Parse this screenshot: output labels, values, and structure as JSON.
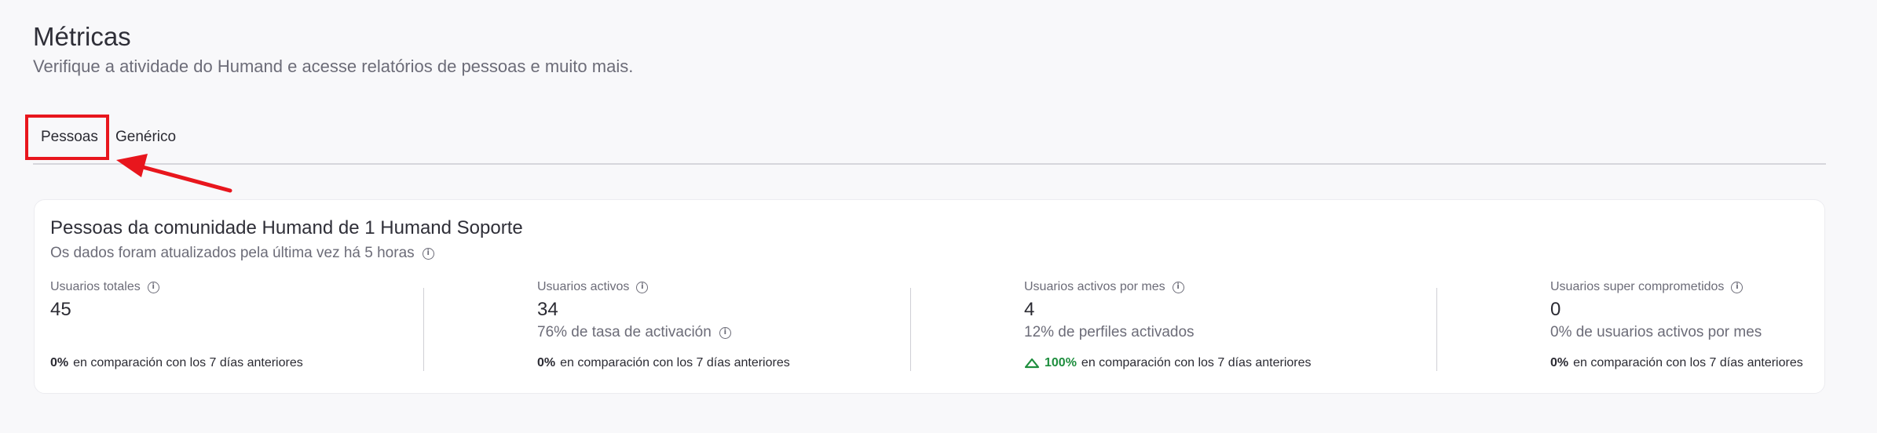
{
  "header": {
    "title": "Métricas",
    "subtitle": "Verifique a atividade do Humand e acesse relatórios de pessoas e muito mais."
  },
  "tabs": [
    {
      "label": "Pessoas",
      "selected": true
    },
    {
      "label": "Genérico",
      "selected": false
    }
  ],
  "card": {
    "title": "Pessoas da comunidade Humand de 1 Humand Soporte",
    "updated": "Os dados foram atualizados pela última vez há 5 horas",
    "metrics": [
      {
        "label": "Usuarios totales",
        "value": "45",
        "extra": "",
        "compare_pct": "0%",
        "compare_text": "en comparación con los 7 días anteriores"
      },
      {
        "label": "Usuarios activos",
        "value": "34",
        "extra": "76% de tasa de activación",
        "compare_pct": "0%",
        "compare_text": "en comparación con los 7 días anteriores"
      },
      {
        "label": "Usuarios activos por mes",
        "value": "4",
        "extra": "12% de perfiles activados",
        "compare_pct": "100%",
        "compare_text": "en comparación con los 7 días anteriores"
      },
      {
        "label": "Usuarios super comprometidos",
        "value": "0",
        "extra": "0% de usuarios activos por mes",
        "compare_pct": "0%",
        "compare_text": "en comparación con los 7 días anteriores"
      }
    ]
  },
  "colors": {
    "annotation": "#e8161d",
    "positive": "#1e8e3e"
  }
}
